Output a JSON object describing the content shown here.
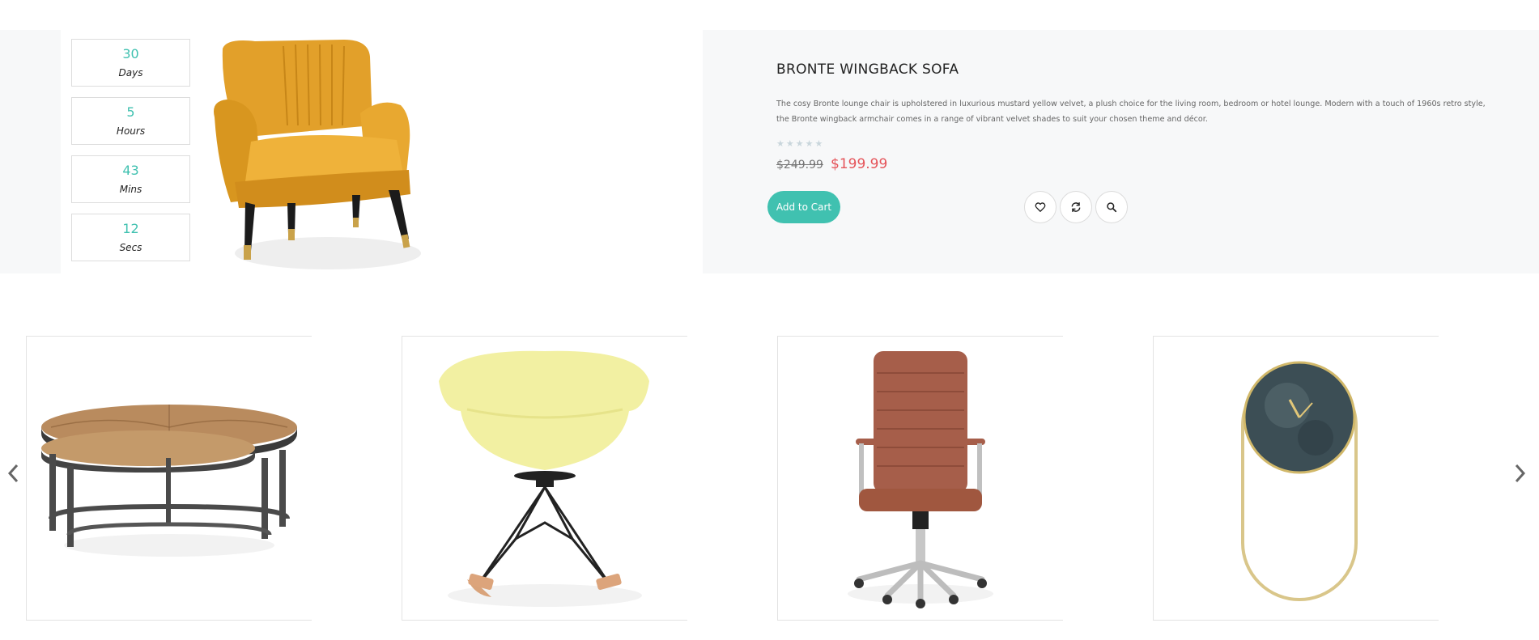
{
  "deal": {
    "countdown": [
      {
        "value": "30",
        "label": "Days"
      },
      {
        "value": "5",
        "label": "Hours"
      },
      {
        "value": "43",
        "label": "Mins"
      },
      {
        "value": "12",
        "label": "Secs"
      }
    ],
    "title": "BRONTE WINGBACK SOFA",
    "description": "The cosy Bronte lounge chair is upholstered in luxurious mustard yellow velvet, a plush choice for the living room, bedroom or hotel lounge. Modern with a touch of 1960s retro style, the Bronte wingback armchair comes in a range of vibrant velvet shades to suit your chosen theme and décor.",
    "rating": 0,
    "rating_max": 5,
    "old_price": "$249.99",
    "new_price": "$199.99",
    "add_to_cart": "Add to Cart",
    "actions": [
      "heart-icon",
      "refresh-icon",
      "search-icon"
    ]
  },
  "carousel": {
    "items": [
      "coffee-table",
      "rocking-chair",
      "office-chair",
      "wall-clock"
    ]
  },
  "colors": {
    "accent": "#40c1b0",
    "sale": "#e5545a",
    "band_bg": "#f7f8f9"
  }
}
